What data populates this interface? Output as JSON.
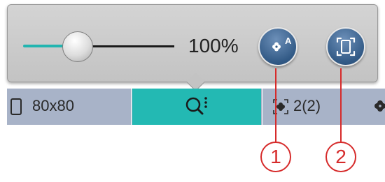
{
  "toolbar": {
    "zoom_level": "100%",
    "zoom_slider_value": 0.3,
    "buttons": [
      {
        "icon": "flower-text-icon",
        "glyph": "A"
      },
      {
        "icon": "fit-to-screen-icon"
      }
    ]
  },
  "tabs": [
    {
      "icon": "hoop-icon",
      "label": "80x80"
    },
    {
      "icon": "zoom-options-icon",
      "active": true
    },
    {
      "icon": "design-count-icon",
      "label": "2(2)"
    },
    {
      "icon": "flower-icon"
    }
  ],
  "callouts": [
    "1",
    "2"
  ],
  "colors": {
    "accent": "#23b9b3",
    "callout": "#d62b2b",
    "button": "#325a86",
    "tabbar": "#a8b3c8"
  }
}
